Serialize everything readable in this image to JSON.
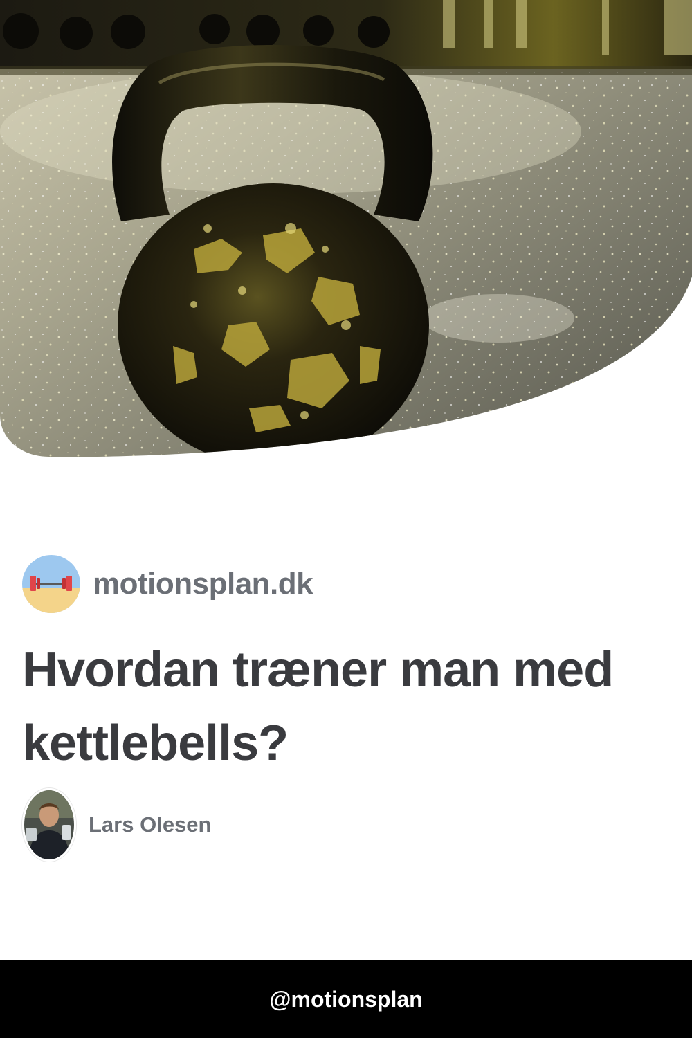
{
  "hero": {
    "image_subject": "kettlebell-photo"
  },
  "site": {
    "logo_icon": "barbell-beach-logo-icon",
    "name": "motionsplan.dk"
  },
  "article": {
    "title": "Hvordan træner man med kettlebells?"
  },
  "author": {
    "avatar_icon": "author-avatar-icon",
    "name": "Lars Olesen"
  },
  "footer": {
    "handle": "@motionsplan"
  },
  "colors": {
    "title": "#3a3b3f",
    "muted_text": "#6b6f76",
    "footer_bg": "#000000",
    "footer_text": "#ffffff"
  }
}
